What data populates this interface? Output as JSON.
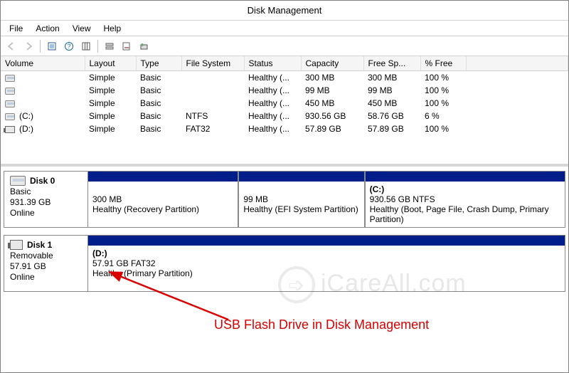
{
  "title": "Disk Management",
  "menu": {
    "file": "File",
    "action": "Action",
    "view": "View",
    "help": "Help"
  },
  "columns": {
    "volume": "Volume",
    "layout": "Layout",
    "type": "Type",
    "fs": "File System",
    "status": "Status",
    "capacity": "Capacity",
    "free": "Free Sp...",
    "pct": "% Free"
  },
  "rows": [
    {
      "vol": "",
      "layout": "Simple",
      "type": "Basic",
      "fs": "",
      "status": "Healthy (...",
      "cap": "300 MB",
      "free": "300 MB",
      "pct": "100 %",
      "kind": "hd"
    },
    {
      "vol": "",
      "layout": "Simple",
      "type": "Basic",
      "fs": "",
      "status": "Healthy (...",
      "cap": "99 MB",
      "free": "99 MB",
      "pct": "100 %",
      "kind": "hd"
    },
    {
      "vol": "",
      "layout": "Simple",
      "type": "Basic",
      "fs": "",
      "status": "Healthy (...",
      "cap": "450 MB",
      "free": "450 MB",
      "pct": "100 %",
      "kind": "hd"
    },
    {
      "vol": "(C:)",
      "layout": "Simple",
      "type": "Basic",
      "fs": "NTFS",
      "status": "Healthy (...",
      "cap": "930.56 GB",
      "free": "58.76 GB",
      "pct": "6 %",
      "kind": "hd"
    },
    {
      "vol": "(D:)",
      "layout": "Simple",
      "type": "Basic",
      "fs": "FAT32",
      "status": "Healthy (...",
      "cap": "57.89 GB",
      "free": "57.89 GB",
      "pct": "100 %",
      "kind": "usb"
    }
  ],
  "disks": [
    {
      "name": "Disk 0",
      "type": "Basic",
      "size": "931.39 GB",
      "state": "Online",
      "icon": "hd",
      "parts": [
        {
          "label": "",
          "line": "300 MB",
          "status": "Healthy (Recovery Partition)",
          "flex": 18
        },
        {
          "label": "",
          "line": "99 MB",
          "status": "Healthy (EFI System Partition)",
          "flex": 15
        },
        {
          "label": "(C:)",
          "line": "930.56 GB NTFS",
          "status": "Healthy (Boot, Page File, Crash Dump, Primary Partition)",
          "flex": 24
        }
      ]
    },
    {
      "name": "Disk 1",
      "type": "Removable",
      "size": "57.91 GB",
      "state": "Online",
      "icon": "usb",
      "parts": [
        {
          "label": "(D:)",
          "line": "57.91 GB FAT32",
          "status": "Healthy (Primary Partition)",
          "flex": 1
        }
      ]
    }
  ],
  "annotation": "USB Flash  Drive in Disk Management",
  "watermark": "iCareAll.com"
}
